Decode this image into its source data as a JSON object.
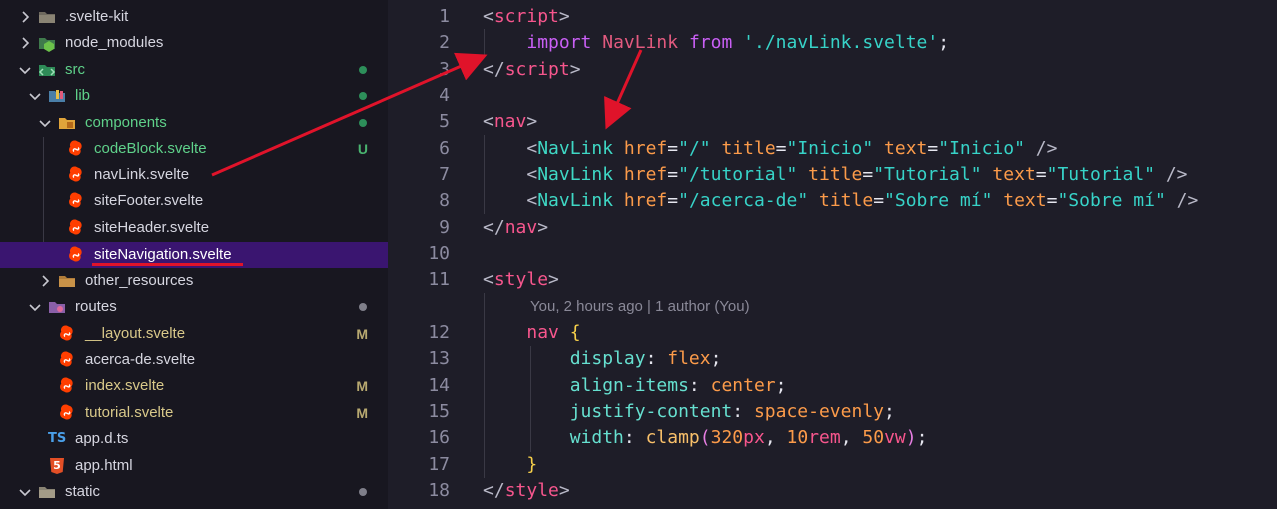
{
  "explorer": {
    "items": [
      {
        "label": ".svelte-kit",
        "icon": "folder-icon",
        "expanded": false,
        "status": ""
      },
      {
        "label": "node_modules",
        "icon": "node-folder-icon",
        "expanded": false,
        "status": ""
      },
      {
        "label": "src",
        "icon": "src-folder-icon",
        "expanded": true,
        "status": "dot-green"
      },
      {
        "label": "lib",
        "icon": "lib-folder-icon",
        "expanded": true,
        "status": "dot-green"
      },
      {
        "label": "components",
        "icon": "components-folder-icon",
        "expanded": true,
        "status": "dot-green"
      },
      {
        "label": "codeBlock.svelte",
        "icon": "svelte-icon",
        "status": "U"
      },
      {
        "label": "navLink.svelte",
        "icon": "svelte-icon",
        "status": ""
      },
      {
        "label": "siteFooter.svelte",
        "icon": "svelte-icon",
        "status": ""
      },
      {
        "label": "siteHeader.svelte",
        "icon": "svelte-icon",
        "status": ""
      },
      {
        "label": "siteNavigation.svelte",
        "icon": "svelte-icon",
        "status": ""
      },
      {
        "label": "other_resources",
        "icon": "folder-icon",
        "expanded": false,
        "status": ""
      },
      {
        "label": "routes",
        "icon": "routes-folder-icon",
        "expanded": true,
        "status": "dot"
      },
      {
        "label": "__layout.svelte",
        "icon": "svelte-icon",
        "status": "M"
      },
      {
        "label": "acerca-de.svelte",
        "icon": "svelte-icon",
        "status": ""
      },
      {
        "label": "index.svelte",
        "icon": "svelte-icon",
        "status": "M"
      },
      {
        "label": "tutorial.svelte",
        "icon": "svelte-icon",
        "status": "M"
      },
      {
        "label": "app.d.ts",
        "icon": "ts-icon",
        "status": ""
      },
      {
        "label": "app.html",
        "icon": "html5-icon",
        "status": ""
      },
      {
        "label": "static",
        "icon": "folder-icon",
        "expanded": true,
        "status": "dot"
      }
    ],
    "selected": "siteNavigation.svelte",
    "ts_glyph": "TS",
    "html_glyph": "5"
  },
  "editor": {
    "line_numbers": [
      "1",
      "2",
      "3",
      "4",
      "5",
      "6",
      "7",
      "8",
      "9",
      "10",
      "11",
      "12",
      "13",
      "14",
      "15",
      "16",
      "17",
      "18"
    ],
    "blame": "You, 2 hours ago | 1 author (You)",
    "code": {
      "l1": [
        "<",
        "script",
        ">"
      ],
      "l2": [
        "import",
        "NavLink",
        "from",
        "'./navLink.svelte'",
        ";"
      ],
      "l3": [
        "</",
        "script",
        ">"
      ],
      "l5": [
        "<",
        "nav",
        ">"
      ],
      "l6": [
        "<",
        "NavLink",
        "href",
        "=",
        "\"/\"",
        "title",
        "=",
        "\"Inicio\"",
        "text",
        "=",
        "\"Inicio\"",
        "/>"
      ],
      "l7": [
        "<",
        "NavLink",
        "href",
        "=",
        "\"/tutorial\"",
        "title",
        "=",
        "\"Tutorial\"",
        "text",
        "=",
        "\"Tutorial\"",
        "/>"
      ],
      "l8": [
        "<",
        "NavLink",
        "href",
        "=",
        "\"/acerca-de\"",
        "title",
        "=",
        "\"Sobre mí\"",
        "text",
        "=",
        "\"Sobre mí\"",
        "/>"
      ],
      "l9": [
        "</",
        "nav",
        ">"
      ],
      "l11": [
        "<",
        "style",
        ">"
      ],
      "l12": [
        "nav",
        "{"
      ],
      "l13": [
        "display",
        ":",
        "flex",
        ";"
      ],
      "l14": [
        "align-items",
        ":",
        "center",
        ";"
      ],
      "l15": [
        "justify-content",
        ":",
        "space-evenly",
        ";"
      ],
      "l16": [
        "width",
        ":",
        "clamp",
        "(",
        "320",
        "px",
        ",",
        "10",
        "rem",
        ",",
        "50",
        "vw",
        ")",
        ";"
      ],
      "l17": [
        "}"
      ],
      "l18": [
        "</",
        "style",
        ">"
      ]
    }
  },
  "colors": {
    "selection": "#3a1570",
    "annotation_red": "#e0132a",
    "svelte": "#ff3e00",
    "modified": "#b8a970",
    "untracked": "#49b36f"
  }
}
